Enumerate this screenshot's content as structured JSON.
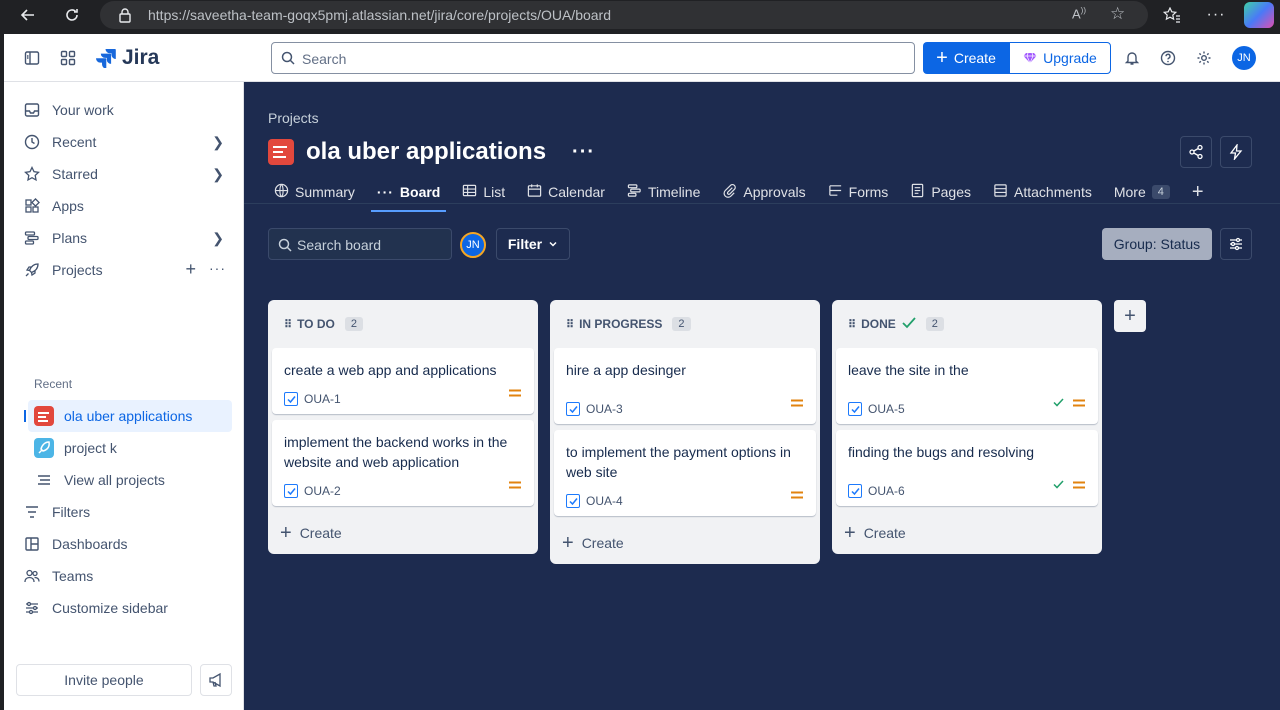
{
  "browser": {
    "url": "https://saveetha-team-goqx5pmj.atlassian.net/jira/core/projects/OUA/board"
  },
  "topnav": {
    "logo_text": "Jira",
    "search_placeholder": "Search",
    "create_label": "Create",
    "upgrade_label": "Upgrade",
    "avatar_initials": "JN"
  },
  "sidebar": {
    "items": [
      {
        "label": "Your work"
      },
      {
        "label": "Recent"
      },
      {
        "label": "Starred"
      },
      {
        "label": "Apps"
      },
      {
        "label": "Plans"
      },
      {
        "label": "Projects"
      }
    ],
    "recent_heading": "Recent",
    "recent_projects": [
      {
        "label": "ola uber applications"
      },
      {
        "label": "project k"
      }
    ],
    "view_all": "View all projects",
    "more_items": [
      {
        "label": "Filters"
      },
      {
        "label": "Dashboards"
      },
      {
        "label": "Teams"
      },
      {
        "label": "Customize sidebar"
      }
    ],
    "invite_label": "Invite people"
  },
  "project": {
    "breadcrumb": "Projects",
    "title": "ola uber applications",
    "tabs": [
      {
        "label": "Summary"
      },
      {
        "label": "Board"
      },
      {
        "label": "List"
      },
      {
        "label": "Calendar"
      },
      {
        "label": "Timeline"
      },
      {
        "label": "Approvals"
      },
      {
        "label": "Forms"
      },
      {
        "label": "Pages"
      },
      {
        "label": "Attachments"
      },
      {
        "label": "More"
      }
    ],
    "more_count": "4"
  },
  "board": {
    "search_placeholder": "Search board",
    "avatar_initials": "JN",
    "filter_label": "Filter",
    "group_label": "Group: Status",
    "create_label": "Create",
    "columns": [
      {
        "title": "TO DO",
        "count": "2",
        "cards": [
          {
            "title": "create a web app and applications",
            "key": "OUA-1"
          },
          {
            "title": "implement the backend works in the website and web application",
            "key": "OUA-2"
          }
        ]
      },
      {
        "title": "IN PROGRESS",
        "count": "2",
        "cards": [
          {
            "title": "hire a app desinger",
            "key": "OUA-3"
          },
          {
            "title": "to implement the payment options in web site",
            "key": "OUA-4"
          }
        ]
      },
      {
        "title": "DONE",
        "count": "2",
        "cards": [
          {
            "title": "leave the site in the",
            "key": "OUA-5"
          },
          {
            "title": "finding the bugs and resolving",
            "key": "OUA-6"
          }
        ]
      }
    ]
  },
  "colors": {
    "accent": "#0c66e4",
    "board_bg": "#1d2b4f",
    "priority_medium": "#e2830f",
    "done_check": "#22a06b"
  }
}
